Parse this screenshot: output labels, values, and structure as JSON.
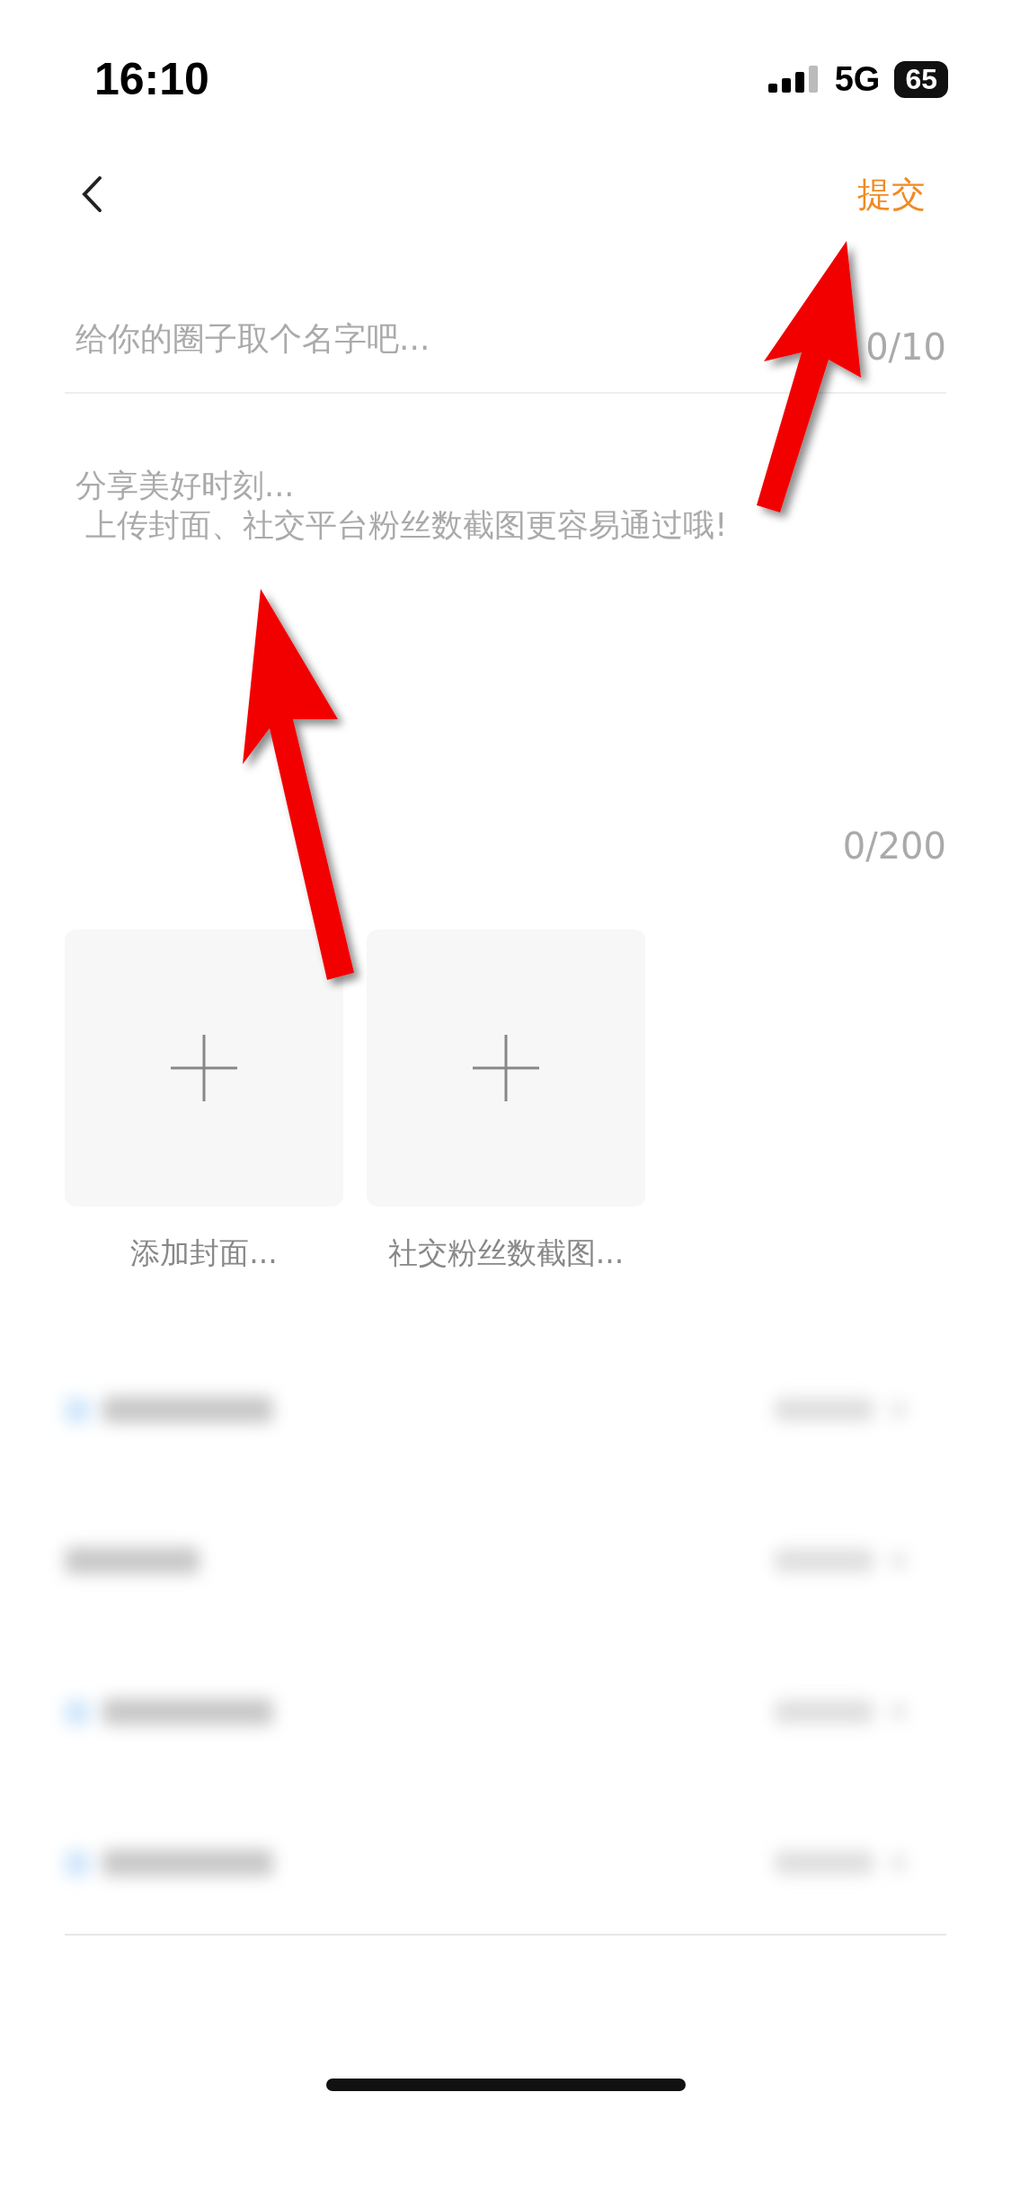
{
  "status_bar": {
    "time": "16:10",
    "network": "5G",
    "battery": "65"
  },
  "nav": {
    "submit": "提交"
  },
  "name_field": {
    "placeholder": "给你的圈子取个名字吧...",
    "counter": "0/10"
  },
  "description_field": {
    "placeholder": "分享美好时刻...\n 上传封面、社交平台粉丝数截图更容易通过哦!",
    "counter": "0/200"
  },
  "uploads": [
    {
      "label": "添加封面..."
    },
    {
      "label": "社交粉丝数截图..."
    }
  ],
  "blurred_rows": [
    {
      "kind": "icon"
    },
    {
      "kind": "plain"
    },
    {
      "kind": "icon"
    },
    {
      "kind": "icon"
    }
  ]
}
